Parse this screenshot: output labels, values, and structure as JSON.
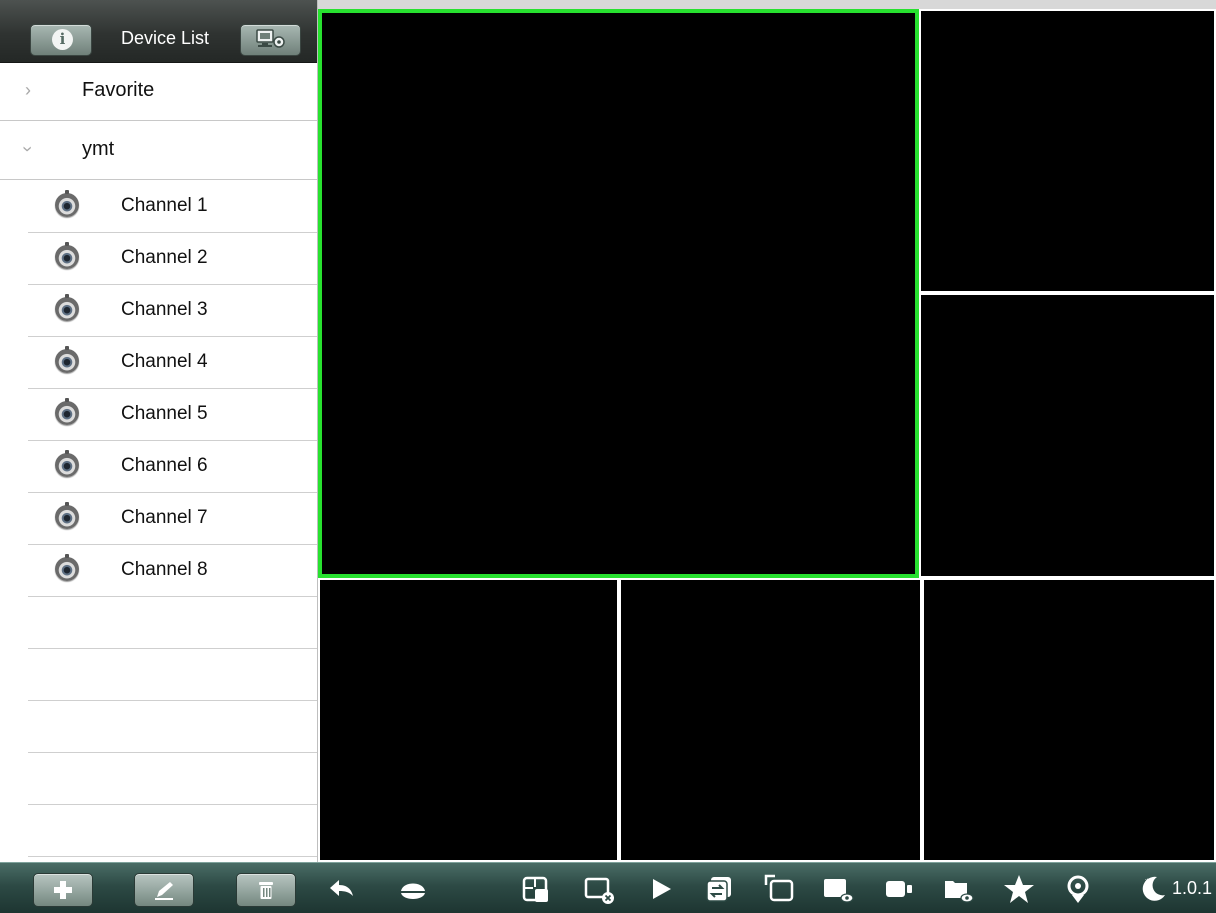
{
  "sidebar": {
    "header": {
      "title": "Device List"
    },
    "tree": [
      {
        "label": "Favorite",
        "expanded": false,
        "chevron": "chevron-right-icon"
      },
      {
        "label": "ymt",
        "expanded": true,
        "chevron": "chevron-down-icon"
      }
    ],
    "channels": [
      {
        "label": "Channel 1",
        "icon": "camera-icon"
      },
      {
        "label": "Channel 2",
        "icon": "camera-icon"
      },
      {
        "label": "Channel 3",
        "icon": "camera-icon"
      },
      {
        "label": "Channel 4",
        "icon": "camera-icon"
      },
      {
        "label": "Channel 5",
        "icon": "camera-icon"
      },
      {
        "label": "Channel 6",
        "icon": "camera-icon"
      },
      {
        "label": "Channel 7",
        "icon": "camera-icon"
      },
      {
        "label": "Channel 8",
        "icon": "camera-icon"
      }
    ]
  },
  "video_grid": {
    "layout": "1 large + 5 small",
    "panes": 6,
    "active_pane": 1,
    "active_color": "#27e12f"
  },
  "toolbar": {
    "left_buttons": [
      "add-icon",
      "edit-icon",
      "delete-icon"
    ],
    "tools": [
      "back-icon",
      "ptz-icon",
      "layout-icon",
      "close-video-icon",
      "play-icon",
      "switch-stream-icon",
      "fullscreen-icon",
      "snapshot-icon",
      "record-icon",
      "recordings-icon",
      "favorite-star-icon",
      "location-icon",
      "night-mode-icon"
    ],
    "version": "1.0.1"
  },
  "colors": {
    "toolbar": "#2d4a45",
    "header": "#2f3331",
    "pane_border": "#ffffff"
  }
}
